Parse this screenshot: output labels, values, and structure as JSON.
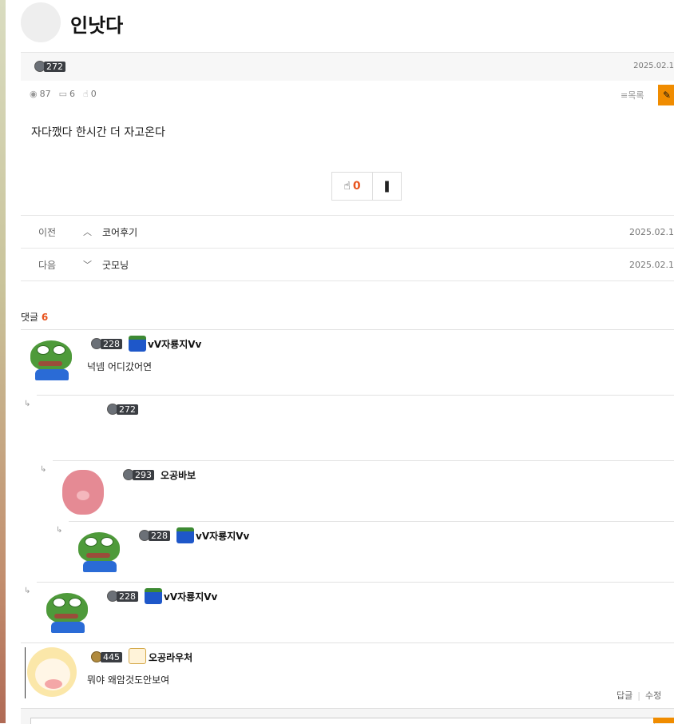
{
  "post": {
    "title": "인낫다",
    "level": "272",
    "date": "2025.02.1",
    "views": "87",
    "comments_count": "6",
    "likes": "0",
    "list_label": "목록",
    "body": "자다깼다 한시간 더 자고온다",
    "vote_count": "0"
  },
  "nav": {
    "prev_label": "이전",
    "prev_title": "코어후기",
    "prev_date": "2025.02.1",
    "next_label": "다음",
    "next_title": "굿모닝",
    "next_date": "2025.02.1"
  },
  "comments_header": {
    "label": "댓글",
    "count": "6"
  },
  "comments": [
    {
      "level": "228",
      "nick": "vV자룡지Vv",
      "text": "넉넴 어디갔어연"
    },
    {
      "level": "272",
      "nick": "",
      "text": ""
    },
    {
      "level": "293",
      "nick": "오공바보",
      "text": ""
    },
    {
      "level": "228",
      "nick": "vV자룡지Vv",
      "text": ""
    },
    {
      "level": "228",
      "nick": "vV자룡지Vv",
      "text": ""
    },
    {
      "level": "445",
      "nick": "오공라우처",
      "text": "뭐야 왜암것도안보여",
      "reply_label": "답글",
      "edit_label": "수정"
    }
  ],
  "icons": {
    "eye": "👁",
    "comment": "💬",
    "thumb": "👍",
    "list": "≡",
    "pencil": "✎",
    "bookmark": "🔖",
    "chevron_up": "⌃",
    "chevron_down": "⌄",
    "reply_arrow": "↳"
  },
  "colors": {
    "accent": "#f08c00",
    "count": "#e8541e"
  }
}
